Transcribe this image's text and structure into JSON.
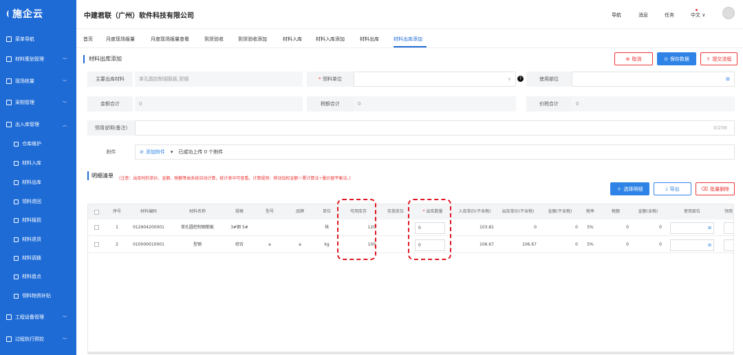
{
  "sidebar": {
    "logo": "施企云",
    "items": [
      {
        "label": "菜单导航"
      },
      {
        "label": "材料策划管理",
        "chevron": "﹀"
      },
      {
        "label": "现场核量",
        "chevron": "﹀"
      },
      {
        "label": "采购管理",
        "chevron": "﹀"
      },
      {
        "label": "出入库管理",
        "chevron": "︿"
      },
      {
        "label": "工程设备管理",
        "chevron": "﹀"
      },
      {
        "label": "过程执行预控",
        "chevron": "﹀"
      }
    ],
    "subitems": [
      {
        "label": "仓库维护"
      },
      {
        "label": "材料入库"
      },
      {
        "label": "材料出库"
      },
      {
        "label": "领料退回"
      },
      {
        "label": "材料报损"
      },
      {
        "label": "材料退货"
      },
      {
        "label": "材料调拨"
      },
      {
        "label": "材料盘点"
      },
      {
        "label": "领料物资补贴"
      }
    ]
  },
  "header": {
    "company": "中建君联（广州）软件科技有限公司",
    "nav": "导航",
    "message": "消息",
    "task": "任务",
    "lang": "中文 ∨"
  },
  "tabs": [
    "首页",
    "月度现场报量",
    "月度现场报量查看",
    "到货验收",
    "到货验收添加",
    "材料入库",
    "材料入库添加",
    "材料出库",
    "材料出库添加"
  ],
  "page": {
    "title": "材料出库添加",
    "cancel": "取消",
    "save": "保存数据",
    "submit": "提交流程"
  },
  "form": {
    "main_material_label": "主要出库材料",
    "main_material_value": "单孔圆控制钢筋板,型钢",
    "receive_unit_label": "领料单位",
    "use_dept_label": "使用部位",
    "amount_label": "金额合计",
    "amount_value": "0",
    "tax_label": "税额合计",
    "tax_value": "0",
    "total_label": "价税合计",
    "total_value": "0",
    "remark_label": "领用说明(备注)",
    "remark_counter": "0/256",
    "attach_label": "附件",
    "attach_add": "添加附件",
    "attach_status": "已成功上传 0 个附件"
  },
  "detail": {
    "title": "明细清单",
    "note": "(注意：出库时的单价、金额、税额等由系统自动计算，统计表中可查看。计算规则：移动加权金额＝累计算法÷量价窗平衡法。)",
    "select_btn": "选择明细",
    "export_btn": "导出",
    "batch_delete_btn": "批量删除"
  },
  "table": {
    "headers": [
      "序号",
      "材料编码",
      "材料名称",
      "规格",
      "型号",
      "品牌",
      "单位",
      "可用库存",
      "存放库位",
      "出库数量",
      "入库单价(不含税)",
      "出库单价(不含税)",
      "金额(不含税)",
      "税率",
      "税额",
      "金额(含税)",
      "使用部位",
      "领用"
    ],
    "rows": [
      {
        "no": "1",
        "code": "012904200001",
        "name": "单孔圆控制钢筋板",
        "spec": "3#钢 5#",
        "model": "",
        "brand": "",
        "unit": "块",
        "stock": "120",
        "location": "",
        "qty": "0",
        "in_price": "103.81",
        "out_price": "0",
        "amount": "0",
        "tax_rate": "5%",
        "tax": "0",
        "amount_tax": "0"
      },
      {
        "no": "2",
        "code": "010000010001",
        "name": "型钢",
        "spec": "综合",
        "model": "a",
        "brand": "a",
        "unit": "kg",
        "stock": "100",
        "location": "",
        "qty": "0",
        "in_price": "106.67",
        "out_price": "106.67",
        "amount": "0",
        "tax_rate": "5%",
        "tax": "0",
        "amount_tax": "0"
      }
    ]
  },
  "colors": {
    "brand": "#1e6bd6",
    "danger": "#e33",
    "highlight": "#e0141e"
  }
}
